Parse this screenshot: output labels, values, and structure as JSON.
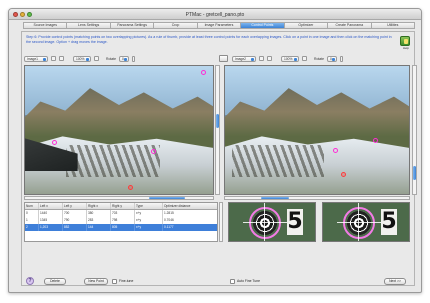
{
  "window": {
    "title": "PTMac - gretcell_pano.pto"
  },
  "tabs": [
    {
      "label": "Source Images",
      "active": false
    },
    {
      "label": "Lens Settings",
      "active": false
    },
    {
      "label": "Panorama Settings",
      "active": false
    },
    {
      "label": "Crop",
      "active": false
    },
    {
      "label": "Image Parameters",
      "active": false
    },
    {
      "label": "Control Points",
      "active": true
    },
    {
      "label": "Optimizer",
      "active": false
    },
    {
      "label": "Create Panorama",
      "active": false
    },
    {
      "label": "Utilities",
      "active": false
    }
  ],
  "instructions": "Step 6: Provide control points (matching points on two overlapping pictures). As a rule of thumb, provide at least three control points for each overlapping images. Click on a point in one image and then click on the matching point in the second image. Option + drag moves the image.",
  "help_label": "Help",
  "left_controls": {
    "image": "Image1",
    "zoom": "100%",
    "rotate_label": "Rotate",
    "rotate": "0"
  },
  "right_controls": {
    "image": "Image2",
    "zoom": "100%",
    "rotate_label": "Rotate",
    "rotate": "0"
  },
  "table": {
    "headers": [
      "Num",
      "Left x",
      "Left y",
      "Right x",
      "Right y",
      "Type",
      "Optimizer distance"
    ],
    "rows": [
      [
        "0",
        "1440",
        "700",
        "380",
        "703",
        "x+y",
        "1.2815"
      ],
      [
        "1",
        "1345",
        "790",
        "283",
        "798",
        "x+y",
        "0.7046"
      ],
      [
        "2",
        "1,203",
        "852",
        "144",
        "805",
        "x+y",
        "0.1177"
      ]
    ],
    "selected_row": 2
  },
  "zoom": {
    "digit": "5"
  },
  "bottom": {
    "help": "?",
    "delete_label": "Delete",
    "new_point_label": "New Point",
    "fine_tune_label": "Fine-tune",
    "auto_fine_tune_label": "Auto Fine Tune",
    "next_label": "Next >>"
  },
  "colors": {
    "accent": "#3b82d6",
    "instruction_text": "#2a56c6",
    "marker": "#ff2bd6",
    "selected_marker": "#ff3b3b"
  }
}
